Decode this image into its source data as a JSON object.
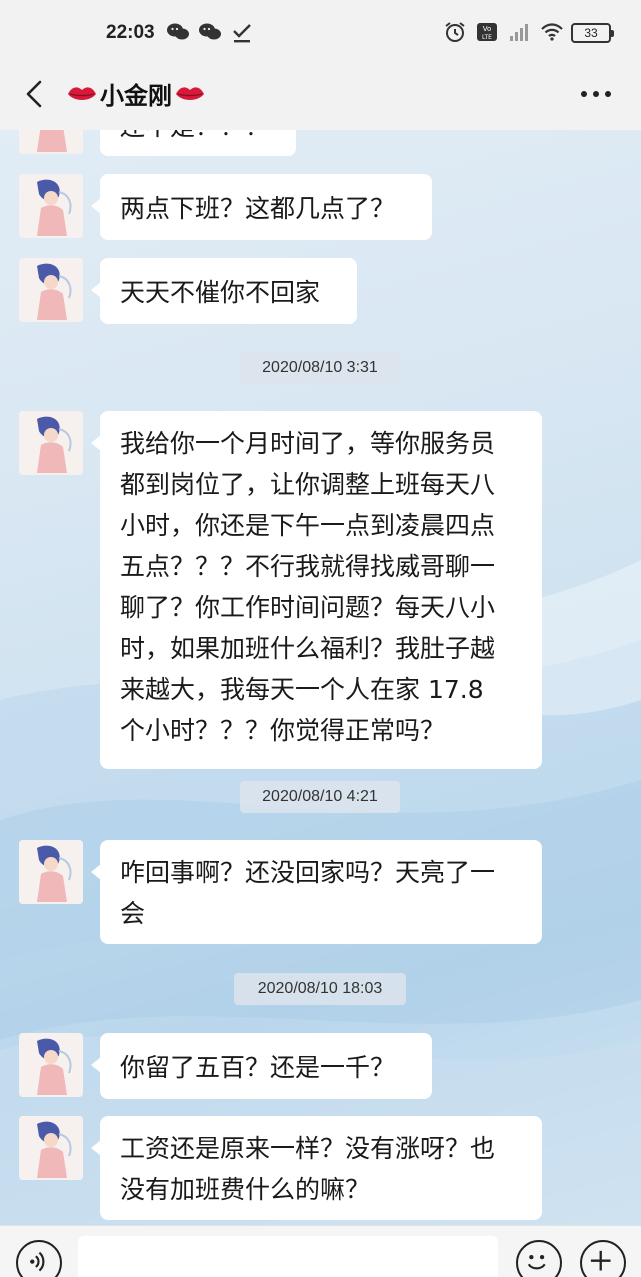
{
  "status_bar": {
    "time": "22:03",
    "left_icons": [
      "wechat-icon",
      "wechat-icon",
      "download-done-icon"
    ],
    "right_icons": [
      "alarm-icon",
      "volte-icon",
      "signal-icon",
      "wifi-icon"
    ],
    "battery": "33"
  },
  "header": {
    "title": "小金刚",
    "title_decoration": "kiss-lips-emoji",
    "back_icon": "chevron-left-icon",
    "more_icon": "more-dots-icon"
  },
  "messages": [
    {
      "type": "bubble",
      "text": "还不是？？？",
      "partial": true
    },
    {
      "type": "bubble",
      "text": "两点下班？这都几点了？"
    },
    {
      "type": "bubble",
      "text": "天天不催你不回家"
    },
    {
      "type": "timestamp",
      "text": "2020/08/10 3:31"
    },
    {
      "type": "bubble",
      "lines": [
        "我给你一个月时间了，等你服务员",
        "都到岗位了，让你调整上班每天八",
        "小时，你还是下午一点到凌晨四点",
        "五点？？？不行我就得找威哥聊一",
        "聊了？你工作时间问题？每天八小",
        "时，如果加班什么福利？我肚子越",
        "来越大，我每天一个人在家 17.8",
        "个小时？？？你觉得正常吗？"
      ]
    },
    {
      "type": "timestamp",
      "text": "2020/08/10 4:21"
    },
    {
      "type": "bubble",
      "lines": [
        "咋回事啊？还没回家吗？天亮了一",
        "会"
      ]
    },
    {
      "type": "timestamp",
      "text": "2020/08/10 18:03"
    },
    {
      "type": "bubble",
      "text": "你留了五百？还是一千？"
    },
    {
      "type": "bubble",
      "lines": [
        "工资还是原来一样？没有涨呀？也",
        "没有加班费什么的嘛？"
      ]
    }
  ],
  "input_bar": {
    "voice_icon": "voice-icon",
    "emoji_icon": "emoji-icon",
    "plus_icon": "plus-icon",
    "placeholder": ""
  },
  "colors": {
    "bubble_bg": "#ffffff",
    "bar_bg": "#f2f2f2",
    "timestamp_bg": "#dce4ec"
  }
}
